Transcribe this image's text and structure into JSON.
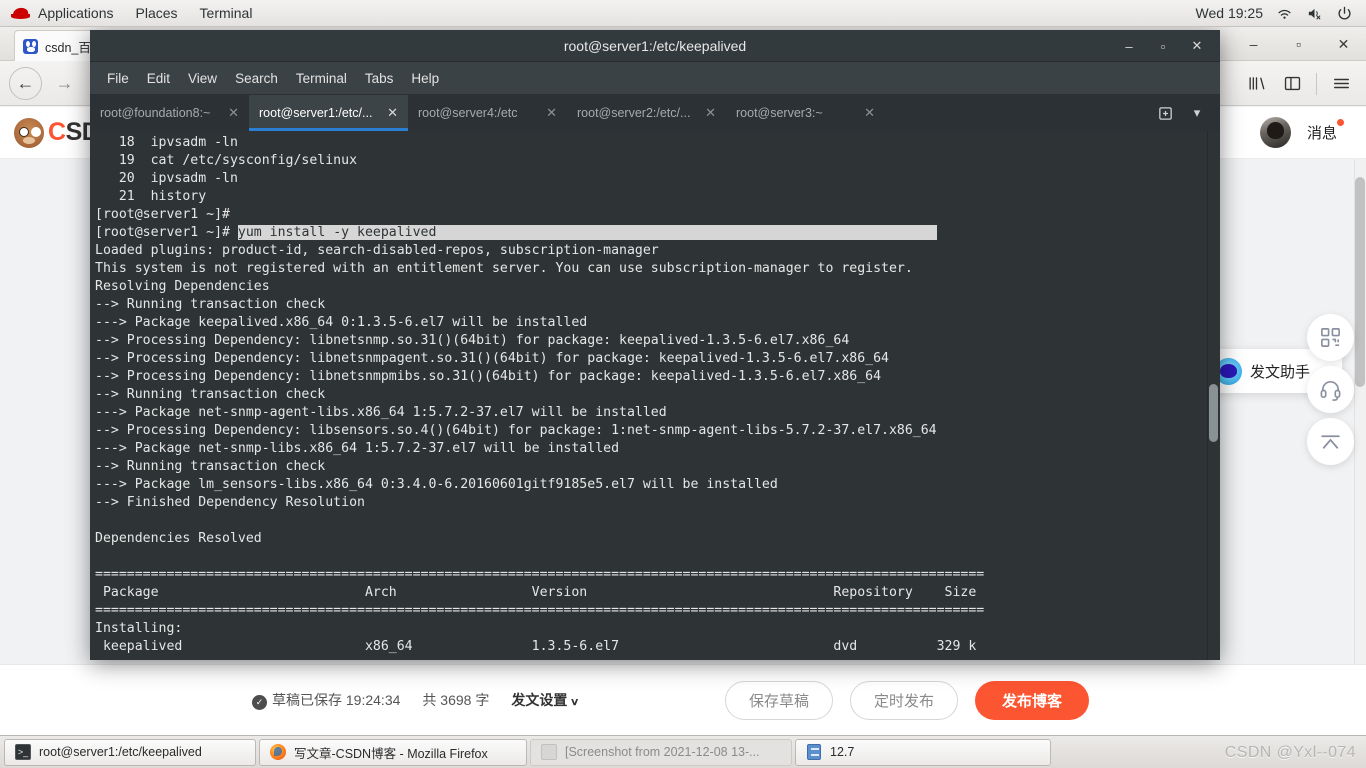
{
  "gnome_bar": {
    "applications": "Applications",
    "places": "Places",
    "terminal": "Terminal",
    "clock": "Wed 19:25",
    "icons": [
      "redhat-logo-icon",
      "wifi-icon",
      "volume-muted-icon",
      "power-icon"
    ]
  },
  "firefox": {
    "tab_title": "csdn_百度",
    "window_controls": {
      "minimize": "–",
      "maximize": "▫",
      "close": "✕"
    },
    "nav": {
      "back": "←",
      "forward": "→",
      "reload": "⟳"
    },
    "toolbar_icons": [
      "library-icon",
      "sidebar-icon",
      "hamburger-menu-icon"
    ]
  },
  "csdn": {
    "logo_text_accent": "C",
    "logo_text_rest": "SDN",
    "messages_label": "消息",
    "assistant_label": "发文助手",
    "fab_icons": [
      "qr-code-icon",
      "headset-support-icon",
      "back-to-top-icon"
    ],
    "footer": {
      "draft_saved": "草稿已保存 19:24:34",
      "word_count": "共 3698 字",
      "publish_settings": "发文设置",
      "save_draft": "保存草稿",
      "schedule_publish": "定时发布",
      "publish": "发布博客",
      "primary_color": "#fc5531"
    }
  },
  "terminal": {
    "title": "root@server1:/etc/keepalived",
    "window_controls": {
      "minimize": "–",
      "maximize": "▫",
      "close": "✕"
    },
    "menus": [
      "File",
      "Edit",
      "View",
      "Search",
      "Terminal",
      "Tabs",
      "Help"
    ],
    "tabs": [
      {
        "label": "root@foundation8:~",
        "active": false
      },
      {
        "label": "root@server1:/etc/...",
        "active": true
      },
      {
        "label": "root@server4:/etc",
        "active": false
      },
      {
        "label": "root@server2:/etc/...",
        "active": false
      },
      {
        "label": "root@server3:~",
        "active": false
      }
    ],
    "tab_extra_icons": [
      "new-tab-icon",
      "tab-list-dropdown-icon"
    ],
    "close_glyph": "✕",
    "content_before_selection": "   18  ipvsadm -ln\n   19  cat /etc/sysconfig/selinux\n   20  ipvsadm -ln\n   21  history\n[root@server1 ~]# \n[root@server1 ~]# ",
    "selected_command": "yum install -y keepalived                                                               ",
    "content_after_selection": "\nLoaded plugins: product-id, search-disabled-repos, subscription-manager\nThis system is not registered with an entitlement server. You can use subscription-manager to register.\nResolving Dependencies\n--> Running transaction check\n---> Package keepalived.x86_64 0:1.3.5-6.el7 will be installed\n--> Processing Dependency: libnetsnmp.so.31()(64bit) for package: keepalived-1.3.5-6.el7.x86_64\n--> Processing Dependency: libnetsnmpagent.so.31()(64bit) for package: keepalived-1.3.5-6.el7.x86_64\n--> Processing Dependency: libnetsnmpmibs.so.31()(64bit) for package: keepalived-1.3.5-6.el7.x86_64\n--> Running transaction check\n---> Package net-snmp-agent-libs.x86_64 1:5.7.2-37.el7 will be installed\n--> Processing Dependency: libsensors.so.4()(64bit) for package: 1:net-snmp-agent-libs-5.7.2-37.el7.x86_64\n---> Package net-snmp-libs.x86_64 1:5.7.2-37.el7 will be installed\n--> Running transaction check\n---> Package lm_sensors-libs.x86_64 0:3.4.0-6.20160601gitf9185e5.el7 will be installed\n--> Finished Dependency Resolution\n\nDependencies Resolved\n\n================================================================================================================\n Package                          Arch                 Version                               Repository    Size\n================================================================================================================\nInstalling:\n keepalived                       x86_64               1.3.5-6.el7                           dvd          329 k"
  },
  "taskbar": {
    "items": [
      {
        "label": "root@server1:/etc/keepalived",
        "icon": "terminal-icon",
        "active": true
      },
      {
        "label": "写文章-CSDN博客 - Mozilla Firefox",
        "icon": "firefox-icon",
        "active": true
      },
      {
        "label": "[Screenshot from 2021-12-08 13-...",
        "icon": "image-viewer-icon",
        "active": false
      },
      {
        "label": "12.7",
        "icon": "file-manager-icon",
        "active": true
      }
    ]
  },
  "watermark": "CSDN @Yxl--074"
}
